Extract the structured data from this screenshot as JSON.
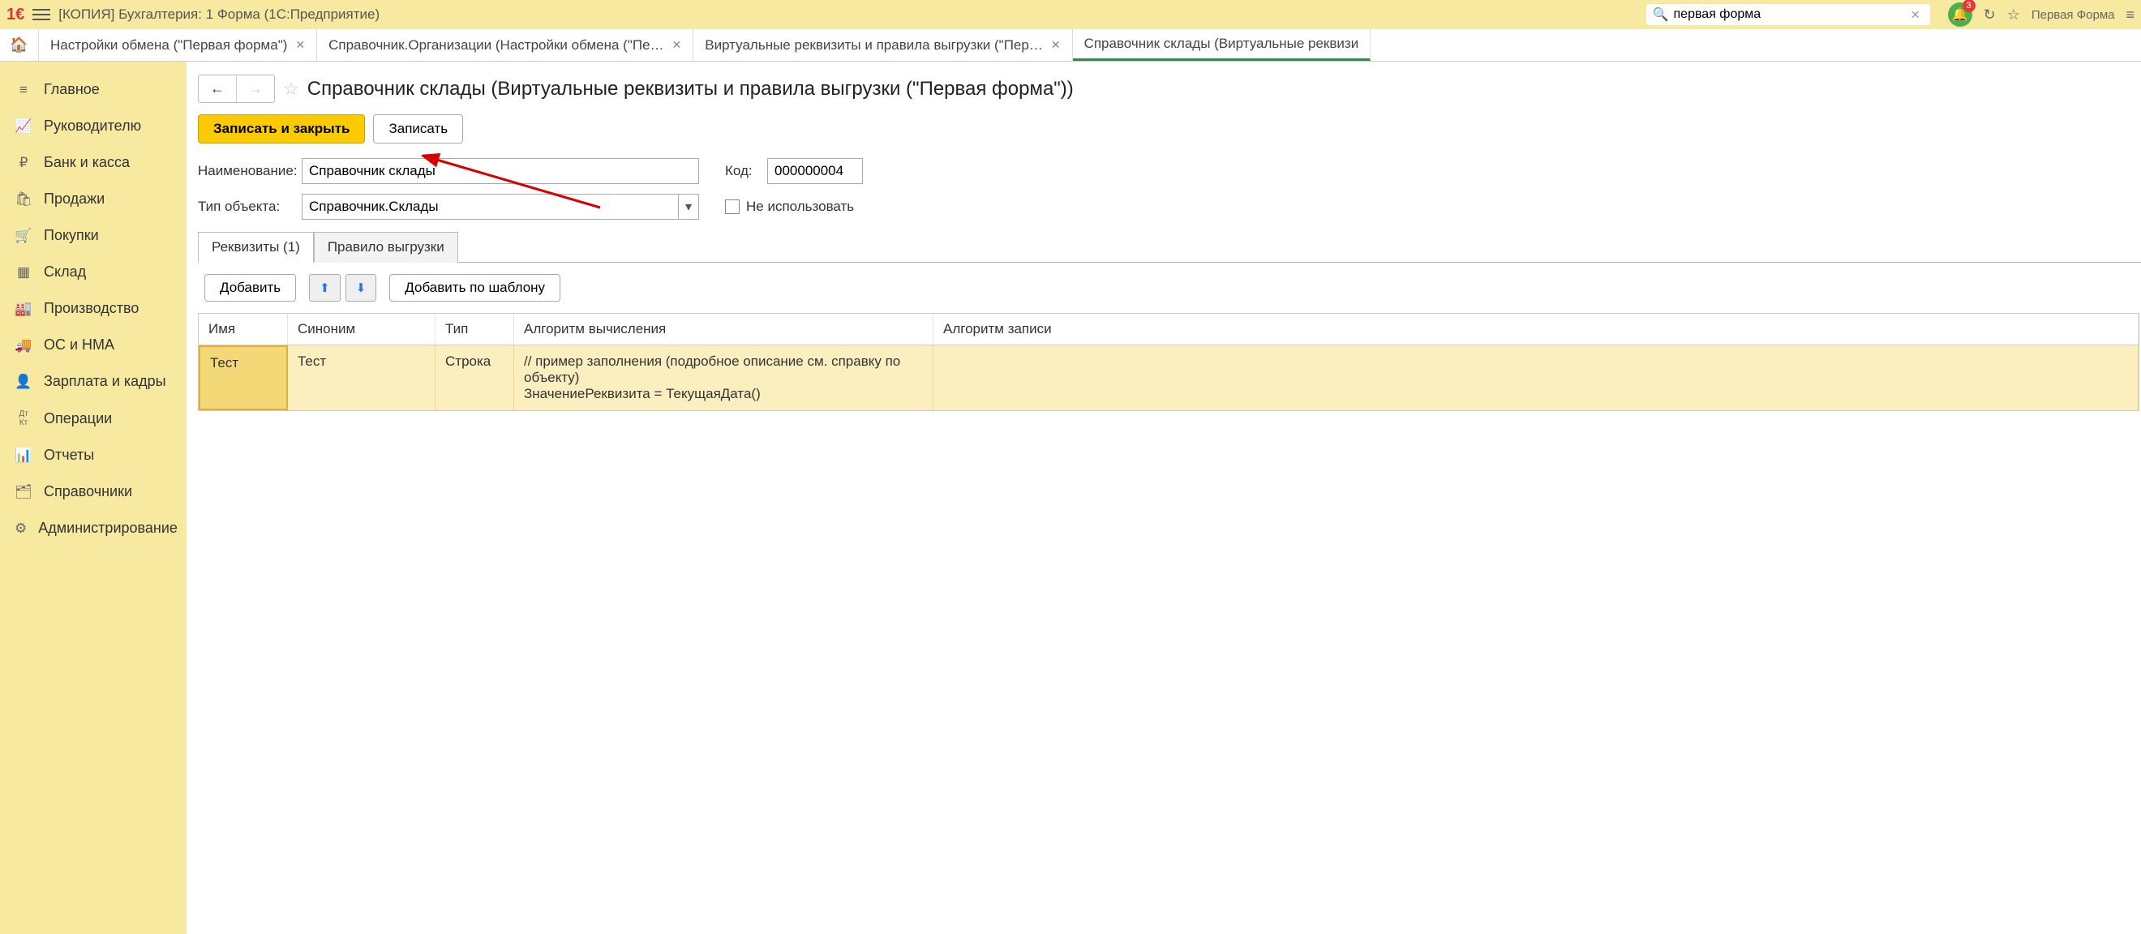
{
  "titlebar": {
    "app_title": "[КОПИЯ] Бухгалтерия: 1 Форма  (1С:Предприятие)",
    "search_value": "первая форма",
    "notif_count": "3",
    "company": "Первая Форма"
  },
  "tabs": [
    {
      "label": "Настройки обмена (\"Первая форма\")"
    },
    {
      "label": "Справочник.Организации (Настройки обмена (\"Пе…"
    },
    {
      "label": "Виртуальные реквизиты и правила выгрузки (\"Пер…"
    },
    {
      "label": "Справочник склады (Виртуальные реквизи"
    }
  ],
  "sidebar": {
    "items": [
      {
        "icon": "≡",
        "label": "Главное"
      },
      {
        "icon": "↗",
        "label": "Руководителю"
      },
      {
        "icon": "₽",
        "label": "Банк и касса"
      },
      {
        "icon": "🛍",
        "label": "Продажи"
      },
      {
        "icon": "🛒",
        "label": "Покупки"
      },
      {
        "icon": "▦",
        "label": "Склад"
      },
      {
        "icon": "🏭",
        "label": "Производство"
      },
      {
        "icon": "🚚",
        "label": "ОС и НМА"
      },
      {
        "icon": "👤",
        "label": "Зарплата и кадры"
      },
      {
        "icon": "Дт/Кт",
        "label": "Операции"
      },
      {
        "icon": "📊",
        "label": "Отчеты"
      },
      {
        "icon": "🗂",
        "label": "Справочники"
      },
      {
        "icon": "⚙",
        "label": "Администрирование"
      }
    ]
  },
  "page": {
    "title": "Справочник склады (Виртуальные реквизиты и правила выгрузки (\"Первая форма\"))",
    "btn_save_close": "Записать и закрыть",
    "btn_save": "Записать",
    "label_name": "Наименование:",
    "name_value": "Справочник склады",
    "label_code": "Код:",
    "code_value": "000000004",
    "label_type": "Тип объекта:",
    "type_value": "Справочник.Склады",
    "check_disable": "Не использовать",
    "subtabs": [
      {
        "label": "Реквизиты (1)"
      },
      {
        "label": "Правило выгрузки"
      }
    ],
    "btn_add": "Добавить",
    "btn_add_tpl": "Добавить по шаблону",
    "cols": {
      "name": "Имя",
      "syn": "Синоним",
      "type": "Тип",
      "alg": "Алгоритм вычисления",
      "alg2": "Алгоритм записи"
    },
    "row": {
      "name": "Тест",
      "syn": "Тест",
      "type": "Строка",
      "alg": "// пример заполнения (подробное описание см. справку по объекту)\nЗначениеРеквизита = ТекущаяДата()"
    }
  }
}
